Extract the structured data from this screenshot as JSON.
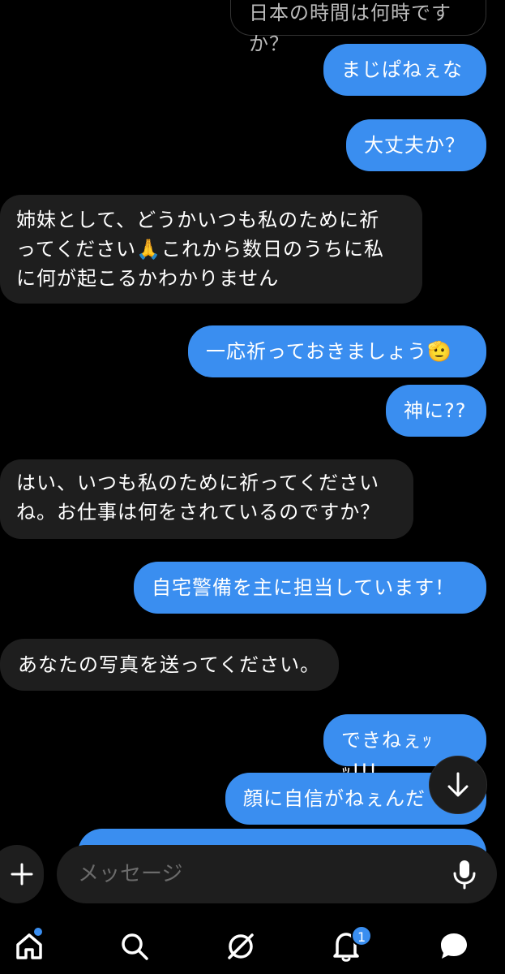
{
  "messages": [
    {
      "side": "in",
      "style": "outline",
      "text": "日本の時間は何時ですか？"
    },
    {
      "side": "out",
      "text": "まじぱねぇな"
    },
    {
      "side": "out",
      "text": "大丈夫か？"
    },
    {
      "side": "in",
      "text": "姉妹として、どうかいつも私のために祈\nってください🙏これから数日のうちに私\nに何が起こるかわかりません"
    },
    {
      "side": "out",
      "text": "一応祈っておきましょう🫡"
    },
    {
      "side": "out",
      "text": "神に??"
    },
    {
      "side": "in",
      "text": "はい、いつも私のために祈ってください\nね。お仕事は何をされているのですか？"
    },
    {
      "side": "out",
      "text": "自宅警備を主に担当しています！"
    },
    {
      "side": "in",
      "text": "あなたの写真を送ってください。"
    },
    {
      "side": "out",
      "text": "できねぇｯｯ!!!"
    },
    {
      "side": "out",
      "text": "顔に自信がねぇんだ"
    }
  ],
  "composer": {
    "placeholder": "メッセージ"
  },
  "nav": {
    "items": [
      "home-icon",
      "search-icon",
      "explore-icon",
      "bell-icon",
      "chat-icon"
    ],
    "notifications_count": "1"
  },
  "colors": {
    "background": "#000000",
    "incoming": "#1e1e1e",
    "outgoing": "#3a8ef0",
    "accent": "#3a8ef0"
  }
}
